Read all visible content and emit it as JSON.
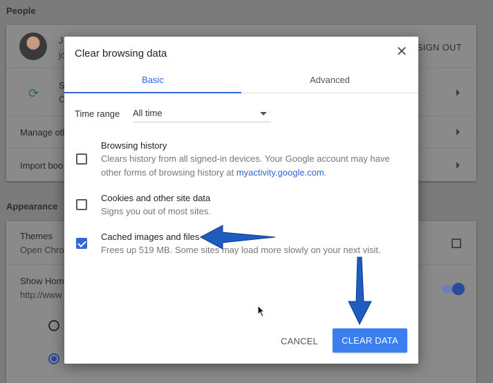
{
  "background": {
    "people_title": "People",
    "user_initial": "J",
    "user_line2": "jo",
    "sign_out": "SIGN OUT",
    "sync_initial": "S",
    "sync_line2": "O",
    "manage_label": "Manage otl",
    "import_label": "Import boo",
    "appearance_title": "Appearance",
    "themes_label": "Themes",
    "themes_sub": "Open Chro",
    "show_home_label": "Show Hom",
    "show_home_sub": "http://www"
  },
  "dialog": {
    "title": "Clear browsing data",
    "tabs": [
      {
        "label": "Basic"
      },
      {
        "label": "Advanced"
      }
    ],
    "time_range_label": "Time range",
    "time_range_value": "All time",
    "options": [
      {
        "title": "Browsing history",
        "desc": "Clears history from all signed-in devices. Your Google account may have other forms of browsing history at ",
        "link": "myactivity.google.com",
        "desc_end": ".",
        "checked": false
      },
      {
        "title": "Cookies and other site data",
        "desc": "Signs you out of most sites.",
        "checked": false
      },
      {
        "title": "Cached images and files",
        "desc": "Frees up 519 MB. Some sites may load more slowly on your next visit.",
        "checked": true
      }
    ],
    "cancel_label": "CANCEL",
    "clear_label": "CLEAR DATA"
  },
  "colors": {
    "accent": "#3367d6",
    "button": "#3a7ef0",
    "annotation_arrow": "#1f5cc0"
  },
  "icons": {
    "close": "close-icon",
    "dropdown": "chevron-down-icon",
    "checkbox_checked": "check-icon"
  }
}
